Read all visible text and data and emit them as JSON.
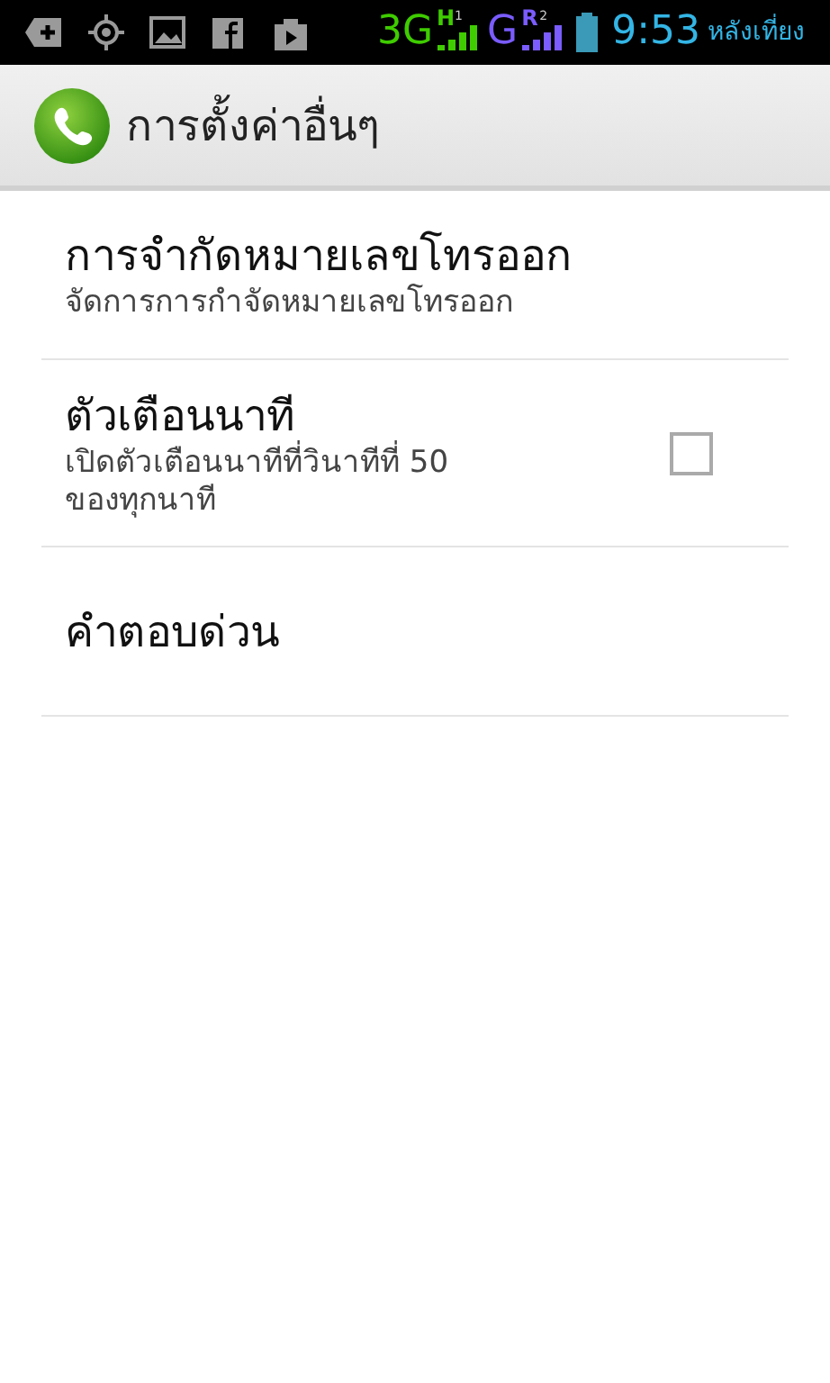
{
  "status_bar": {
    "network_1": "3G",
    "network_1_type": "H",
    "sim_1": "1",
    "network_2": "G",
    "network_2_type": "R",
    "sim_2": "2",
    "time": "9:53",
    "period": "หลังเที่ยง"
  },
  "action_bar": {
    "title": "การตั้งค่าอื่นๆ"
  },
  "settings": [
    {
      "kind": "link",
      "title": "การจำกัดหมายเลขโทรออก",
      "summary": "จัดการการกำจัดหมายเลขโทรออก"
    },
    {
      "kind": "checkbox",
      "title": "ตัวเตือนนาที",
      "summary": "เปิดตัวเตือนนาทีที่วินาทีที่ 50\nของทุกนาที",
      "checked": false
    },
    {
      "kind": "link",
      "title": "คำตอบด่วน"
    }
  ]
}
